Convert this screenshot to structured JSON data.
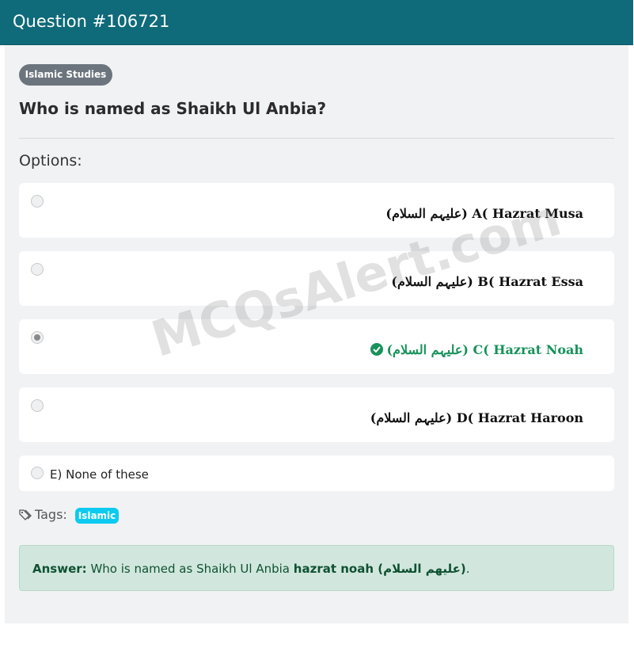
{
  "header": {
    "title": "Question #106721"
  },
  "category_badge": "Islamic Studies",
  "question": "Who is named as Shaikh Ul Anbia?",
  "options_label": "Options:",
  "options": [
    {
      "text": "(علیہم السلام) A( Hazrat Musa",
      "selected": false,
      "correct": false
    },
    {
      "text": "(علیہم السلام) B( Hazrat Essa",
      "selected": false,
      "correct": false
    },
    {
      "text": "(علیہم السلام) C( Hazrat Noah",
      "selected": true,
      "correct": true
    },
    {
      "text": "(علیہم السلام) D( Hazrat Haroon",
      "selected": false,
      "correct": false
    },
    {
      "text": "E) None of these",
      "selected": false,
      "correct": false
    }
  ],
  "watermark": "MCQsAlert.com",
  "tags": {
    "label": "Tags:",
    "items": [
      "Islamic"
    ]
  },
  "answer": {
    "label": "Answer:",
    "text": "Who is named as Shaikh Ul Anbia",
    "value": "hazrat noah (علیھم السلام)",
    "end": "."
  },
  "colors": {
    "header": "#0f6a7a",
    "correct": "#16925a",
    "tag": "#0dcaf0",
    "answer_bg": "#d1e7dd"
  },
  "icons": {
    "correct": "check-circle-icon",
    "tags": "tags-icon"
  }
}
